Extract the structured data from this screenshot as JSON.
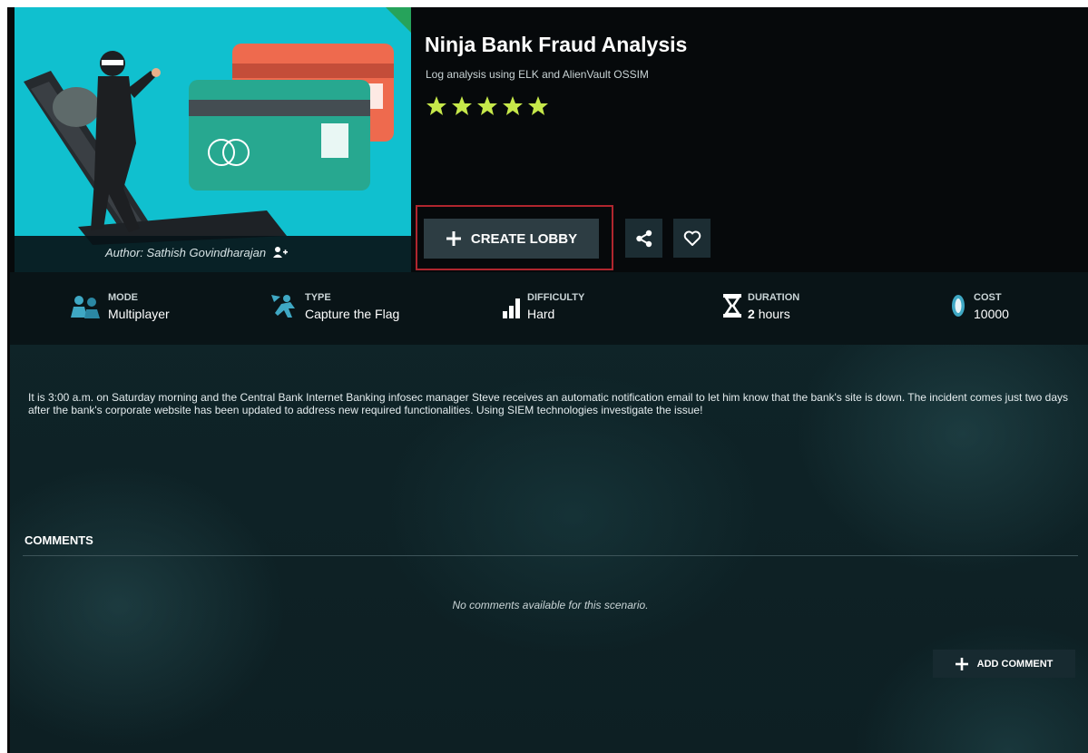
{
  "scenario": {
    "title": "Ninja Bank Fraud Analysis",
    "subtitle": "Log analysis using ELK and AlienVault OSSIM",
    "rating": 5,
    "author": "Author: Sathish Govindharajan"
  },
  "actions": {
    "create_lobby": "CREATE LOBBY",
    "share_icon": "share-icon",
    "favorite_icon": "heart-icon"
  },
  "stats": [
    {
      "label": "MODE",
      "value": "Multiplayer",
      "icon": "multiplayer-icon"
    },
    {
      "label": "TYPE",
      "value": "Capture the Flag",
      "icon": "flag-runner-icon"
    },
    {
      "label": "DIFFICULTY",
      "value": "Hard",
      "icon": "difficulty-bars-icon"
    },
    {
      "label": "DURATION",
      "value_num": "2",
      "value_unit": "hours",
      "icon": "hourglass-icon"
    },
    {
      "label": "COST",
      "value": "10000",
      "icon": "coin-icon"
    }
  ],
  "description": "It is 3:00 a.m. on Saturday morning and the Central Bank Internet Banking infosec manager Steve receives an automatic notification email to let him know that the bank's site is down. The incident comes just two days after the bank's corporate website has been updated to address new required functionalities. Using SIEM technologies investigate the issue!",
  "comments": {
    "title": "COMMENTS",
    "empty_text": "No comments available for this scenario.",
    "add_label": "ADD COMMENT"
  },
  "colors": {
    "accent_star": "#c6e84a",
    "highlight_border": "#b0262e",
    "cover_bg": "#10c0cf"
  }
}
